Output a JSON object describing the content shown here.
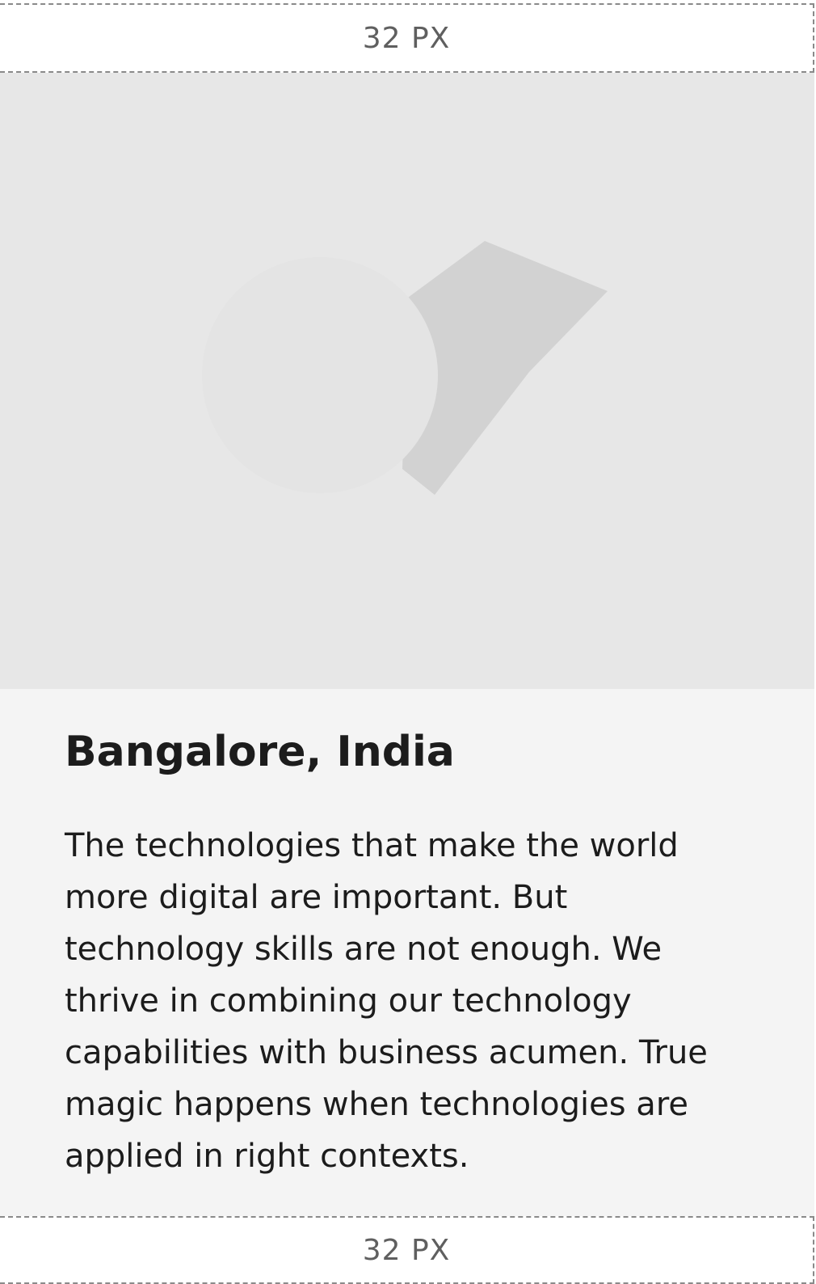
{
  "spacing": {
    "top_label": "32 PX",
    "bottom_label": "32 PX"
  },
  "card": {
    "image_icon": "image-placeholder-icon",
    "title": "Bangalore, India",
    "description": "The technologies that make the world more digital are important. But technology skills are not enough. We thrive in combining our technology capabilities with business acumen. True magic happens when technologies are applied in right contexts."
  },
  "colors": {
    "card_background": "#f4f4f4",
    "media_background": "#e7e7e7",
    "placeholder_shape": "#d2d2d2",
    "text": "#1c1c1c",
    "guide": "#8a8a8a"
  }
}
